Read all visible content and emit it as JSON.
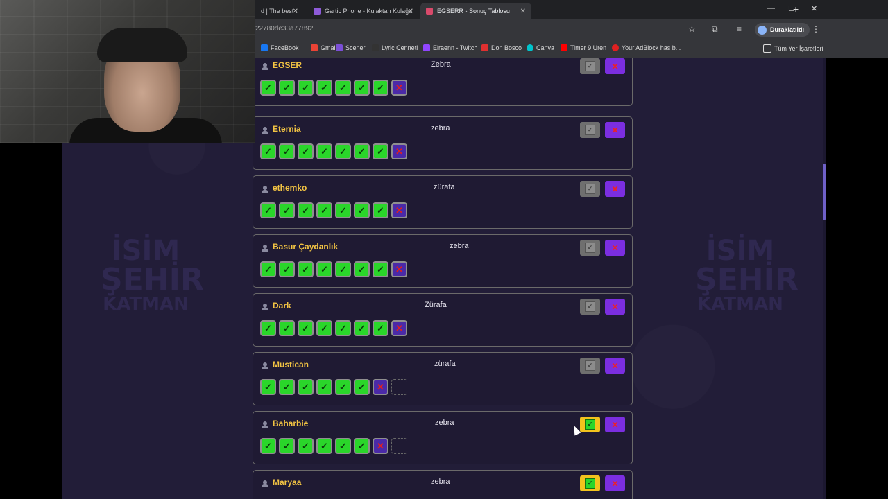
{
  "browser": {
    "tabs": [
      {
        "title": "d | The best t",
        "favicon_color": "#555"
      },
      {
        "title": "Gartic Phone - Kulaktan Kulağa",
        "favicon_color": "#8e5bd9"
      },
      {
        "title": "EGSERR - Sonuç Tablosu",
        "favicon_color": "#d94a6b",
        "active": true
      }
    ],
    "new_tab": "+",
    "url": "22780de33a77892",
    "profile_label": "Duraklatıldı",
    "bookmarks": [
      {
        "label": "FaceBook",
        "color": "#1877f2"
      },
      {
        "label": "Gmail",
        "color": "#ea4335"
      },
      {
        "label": "Scener",
        "color": "#7b4fd6"
      },
      {
        "label": "Lyric Cenneti",
        "color": "#333"
      },
      {
        "label": "Elraenn - Twitch",
        "color": "#9146ff"
      },
      {
        "label": "Don Bosco",
        "color": "#e03030"
      },
      {
        "label": "Canva",
        "color": "#00c4cc"
      },
      {
        "label": "Timer 9 Uren",
        "color": "#ff0000"
      },
      {
        "label": "Your AdBlock has b...",
        "color": "#e02020"
      }
    ],
    "bookmarks_folder": "Tüm Yer İşaretleri"
  },
  "watermark": {
    "line1": "İSİM",
    "line2": "ŞEHİR",
    "line3": "KATMAN"
  },
  "players": [
    {
      "name": "EGSER",
      "answer": "Zebra",
      "results": [
        "ok",
        "ok",
        "ok",
        "ok",
        "ok",
        "ok",
        "ok",
        "no"
      ],
      "approved": false
    },
    {
      "name": "Eternia",
      "answer": "zebra",
      "results": [
        "ok",
        "ok",
        "ok",
        "ok",
        "ok",
        "ok",
        "ok",
        "no"
      ],
      "approved": false
    },
    {
      "name": "ethemko",
      "answer": "zürafa",
      "results": [
        "ok",
        "ok",
        "ok",
        "ok",
        "ok",
        "ok",
        "ok",
        "no"
      ],
      "approved": false
    },
    {
      "name": "Basur Çaydanlık",
      "answer": "zebra",
      "results": [
        "ok",
        "ok",
        "ok",
        "ok",
        "ok",
        "ok",
        "ok",
        "no"
      ],
      "approved": false
    },
    {
      "name": "Dark",
      "answer": "Zürafa",
      "results": [
        "ok",
        "ok",
        "ok",
        "ok",
        "ok",
        "ok",
        "ok",
        "no"
      ],
      "approved": false
    },
    {
      "name": "Mustican",
      "answer": "zürafa",
      "results": [
        "ok",
        "ok",
        "ok",
        "ok",
        "ok",
        "ok",
        "no",
        "empty"
      ],
      "approved": false
    },
    {
      "name": "Baharbie",
      "answer": "zebra",
      "results": [
        "ok",
        "ok",
        "ok",
        "ok",
        "ok",
        "ok",
        "no",
        "empty"
      ],
      "approved": true
    },
    {
      "name": "Maryaa",
      "answer": "zebra",
      "results": [],
      "approved": true
    }
  ],
  "icons": {
    "check": "✓",
    "cross": "✕"
  }
}
